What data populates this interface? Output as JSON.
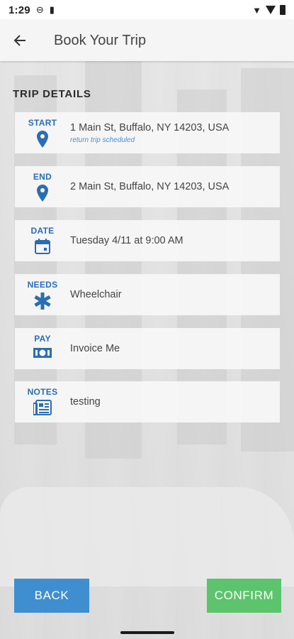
{
  "status": {
    "time": "1:29"
  },
  "header": {
    "title": "Book Your Trip"
  },
  "section": {
    "title": "TRIP DETAILS"
  },
  "details": [
    {
      "label": "START",
      "icon": "map-pin-icon",
      "value": "1 Main St, Buffalo, NY 14203, USA",
      "note": "return trip scheduled"
    },
    {
      "label": "END",
      "icon": "map-pin-icon",
      "value": "2 Main St, Buffalo, NY 14203, USA"
    },
    {
      "label": "DATE",
      "icon": "calendar-icon",
      "value": "Tuesday 4/11 at 9:00 AM"
    },
    {
      "label": "NEEDS",
      "icon": "medical-star-icon",
      "value": "Wheelchair"
    },
    {
      "label": "PAY",
      "icon": "money-icon",
      "value": "Invoice Me"
    },
    {
      "label": "NOTES",
      "icon": "notes-icon",
      "value": "testing"
    }
  ],
  "actions": {
    "back": "BACK",
    "confirm": "CONFIRM"
  },
  "colors": {
    "accent": "#2a6db3",
    "back_button": "#3f8ed0",
    "confirm_button": "#5cc46c"
  }
}
